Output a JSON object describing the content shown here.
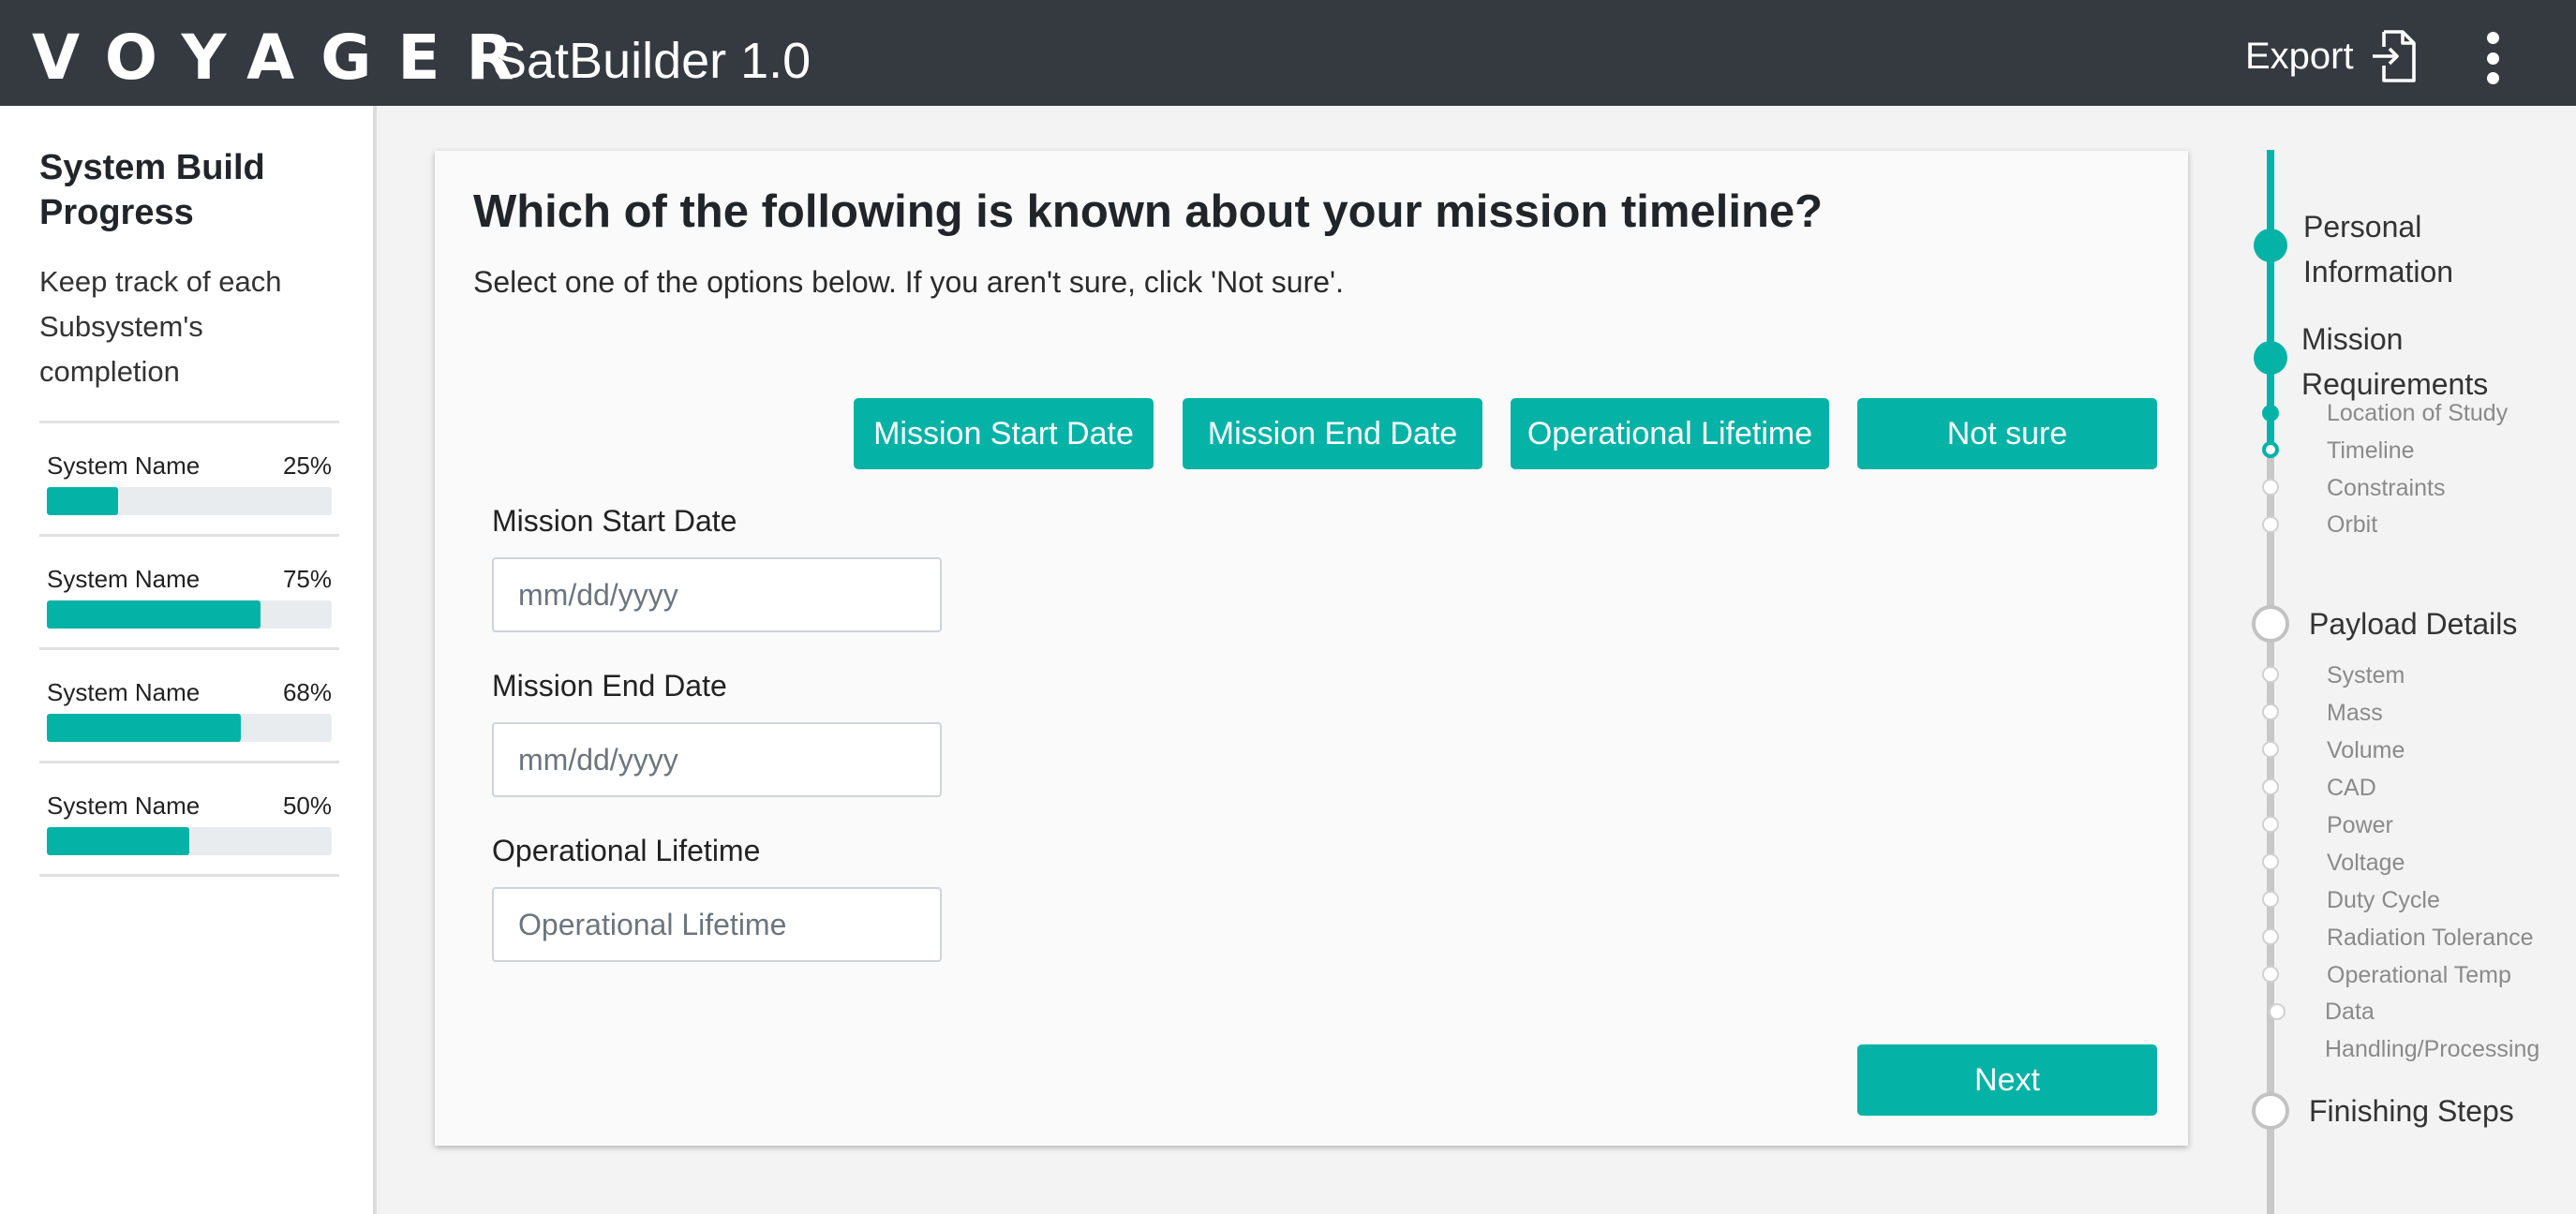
{
  "header": {
    "logo": "VOYAGER",
    "app_name": "SatBuilder 1.0",
    "export_label": "Export"
  },
  "sidebar": {
    "title": "System Build Progress",
    "description": "Keep track of each Subsystem's completion",
    "systems": [
      {
        "name": "System Name",
        "percent_label": "25%",
        "progress": 0.25
      },
      {
        "name": "System Name",
        "percent_label": "75%",
        "progress": 0.75
      },
      {
        "name": "System Name",
        "percent_label": "68%",
        "progress": 0.68
      },
      {
        "name": "System Name",
        "percent_label": "50%",
        "progress": 0.5
      }
    ]
  },
  "main": {
    "question": "Which of the following is known about your mission timeline?",
    "instruction": "Select one of the options below. If you aren't sure, click 'Not sure'.",
    "options": [
      "Mission Start Date",
      "Mission End Date",
      "Operational Lifetime",
      "Not sure"
    ],
    "fields": [
      {
        "label": "Mission Start Date",
        "placeholder": "mm/dd/yyyy"
      },
      {
        "label": "Mission End Date",
        "placeholder": "mm/dd/yyyy"
      },
      {
        "label": "Operational Lifetime",
        "placeholder": "Operational Lifetime"
      }
    ],
    "next_label": "Next"
  },
  "stepper": {
    "steps": [
      {
        "label": "Personal Information",
        "state": "done"
      },
      {
        "label": "Mission Requirements",
        "state": "done",
        "substeps": [
          {
            "label": "Location of Study",
            "state": "done"
          },
          {
            "label": "Timeline",
            "state": "active"
          },
          {
            "label": "Constraints",
            "state": "todo"
          },
          {
            "label": "Orbit",
            "state": "todo"
          }
        ]
      },
      {
        "label": "Payload Details",
        "state": "todo",
        "substeps": [
          {
            "label": "System",
            "state": "todo"
          },
          {
            "label": "Mass",
            "state": "todo"
          },
          {
            "label": "Volume",
            "state": "todo"
          },
          {
            "label": "CAD",
            "state": "todo"
          },
          {
            "label": "Power",
            "state": "todo"
          },
          {
            "label": "Voltage",
            "state": "todo"
          },
          {
            "label": "Duty Cycle",
            "state": "todo"
          },
          {
            "label": "Radiation Tolerance",
            "state": "todo"
          },
          {
            "label": "Operational Temp",
            "state": "todo"
          },
          {
            "label": "Data Handling/Processing",
            "state": "todo"
          }
        ]
      },
      {
        "label": "Finishing Steps",
        "state": "todo"
      }
    ]
  },
  "colors": {
    "header_bg": "#353a41",
    "accent": "#05b2a6",
    "page_bg": "#f3f3f3"
  }
}
